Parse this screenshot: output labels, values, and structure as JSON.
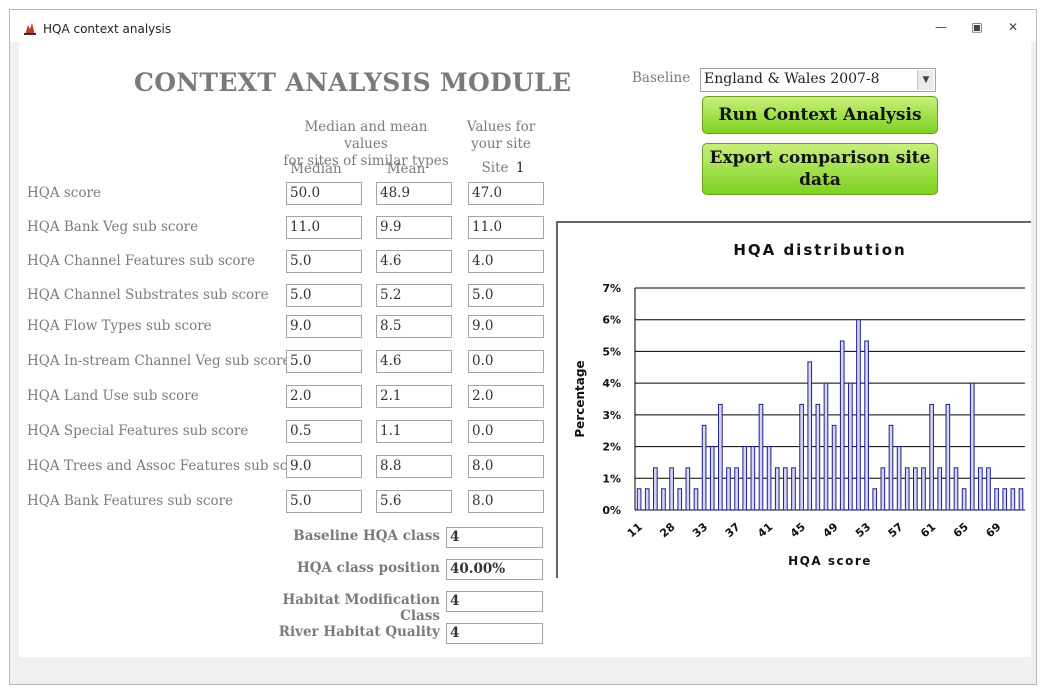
{
  "window": {
    "title": "HQA context analysis",
    "minimize_icon": "minimize-icon",
    "restore_icon": "restore-icon",
    "close_icon": "close-icon"
  },
  "module_title": "CONTEXT ANALYSIS MODULE",
  "baseline": {
    "label": "Baseline",
    "value": "England & Wales 2007-8"
  },
  "buttons": {
    "run": "Run Context Analysis",
    "export_line1": "Export comparison site",
    "export_line2": "data"
  },
  "headers": {
    "similar_line1": "Median and mean values",
    "similar_line2": "for sites of similar types",
    "site_line1": "Values for",
    "site_line2": "your site",
    "median": "Median",
    "mean": "Mean",
    "site": "Site",
    "site_number": "1"
  },
  "rows": [
    {
      "label": "HQA score",
      "median": "50.0",
      "mean": "48.9",
      "site": "47.0"
    },
    {
      "label": "HQA Bank Veg sub score",
      "median": "11.0",
      "mean": "9.9",
      "site": "11.0"
    },
    {
      "label": "HQA Channel Features sub score",
      "median": "5.0",
      "mean": "4.6",
      "site": "4.0"
    },
    {
      "label": "HQA Channel Substrates sub score",
      "median": "5.0",
      "mean": "5.2",
      "site": "5.0"
    },
    {
      "label": "HQA Flow Types sub score",
      "median": "9.0",
      "mean": "8.5",
      "site": "9.0"
    },
    {
      "label": "HQA In-stream Channel Veg sub score",
      "median": "5.0",
      "mean": "4.6",
      "site": "0.0"
    },
    {
      "label": "HQA Land Use sub score",
      "median": "2.0",
      "mean": "2.1",
      "site": "2.0"
    },
    {
      "label": "HQA Special Features sub score",
      "median": "0.5",
      "mean": "1.1",
      "site": "0.0"
    },
    {
      "label": "HQA Trees and Assoc Features sub score",
      "median": "9.0",
      "mean": "8.8",
      "site": "8.0"
    },
    {
      "label": "HQA Bank Features sub score",
      "median": "5.0",
      "mean": "5.6",
      "site": "8.0"
    }
  ],
  "bottom": [
    {
      "label": "Baseline HQA class",
      "value": "4"
    },
    {
      "label": "HQA class position",
      "value": "40.00%"
    },
    {
      "label": "Habitat Modification Class",
      "value": "4"
    },
    {
      "label": "River Habitat Quality",
      "value": "4"
    }
  ],
  "chart_data": {
    "type": "bar",
    "title": "HQA distribution",
    "xlabel": "HQA score",
    "ylabel": "Percentage",
    "ylim": [
      0,
      7
    ],
    "yticks": [
      "0%",
      "1%",
      "2%",
      "3%",
      "4%",
      "5%",
      "6%",
      "7%"
    ],
    "grid": true,
    "bar_color": "#1f1f8f",
    "x_tick_labels": [
      "11",
      "28",
      "33",
      "37",
      "41",
      "45",
      "49",
      "53",
      "57",
      "61",
      "65",
      "69"
    ],
    "categories": [
      "11",
      "12",
      "13",
      "14",
      "15",
      "16",
      "17",
      "18",
      "19",
      "20",
      "21",
      "22",
      "23",
      "24",
      "25",
      "26",
      "27",
      "28",
      "29",
      "30",
      "31",
      "32",
      "33",
      "34",
      "35",
      "36",
      "37",
      "38",
      "39",
      "40",
      "41",
      "42",
      "43",
      "44",
      "45",
      "46",
      "47",
      "48",
      "49",
      "50",
      "51",
      "52",
      "53",
      "54",
      "55",
      "56",
      "57",
      "58",
      "59",
      "60",
      "61",
      "62",
      "63",
      "64",
      "65",
      "66",
      "67",
      "68",
      "69",
      "70",
      "71"
    ],
    "values": [
      0.67,
      0.67,
      1.33,
      0.67,
      1.33,
      0.67,
      1.33,
      0.67,
      2.67,
      2.0,
      3.33,
      1.33,
      1.33,
      2.0,
      2.0,
      3.33,
      2.0,
      1.33,
      1.33,
      1.33,
      3.33,
      4.67,
      3.33,
      4.0,
      2.67,
      5.33,
      4.0,
      6.0,
      5.33,
      0.67,
      1.33,
      2.67,
      2.0,
      1.33,
      1.33,
      1.33,
      3.33,
      1.33,
      3.33,
      1.33,
      0.67,
      4.0,
      1.33,
      1.33,
      0.67,
      0.67,
      0.67,
      0.67
    ]
  }
}
